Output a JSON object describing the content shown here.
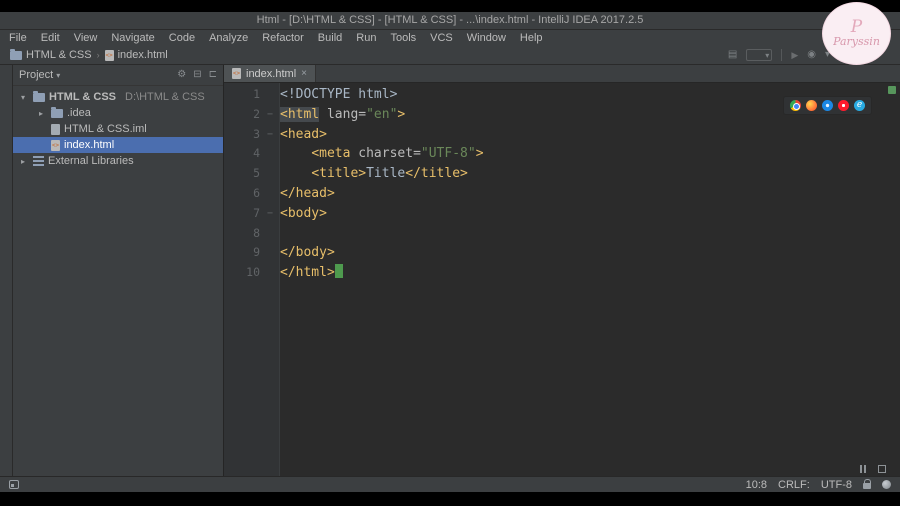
{
  "window": {
    "title": "Html - [D:\\HTML & CSS] - [HTML & CSS] - ...\\index.html - IntelliJ IDEA 2017.2.5"
  },
  "menu": {
    "items": [
      "File",
      "Edit",
      "View",
      "Navigate",
      "Code",
      "Analyze",
      "Refactor",
      "Build",
      "Run",
      "Tools",
      "VCS",
      "Window",
      "Help"
    ]
  },
  "navbar": {
    "crumbs": [
      "HTML & CSS",
      "index.html"
    ]
  },
  "project": {
    "header": "Project",
    "items": [
      {
        "label": "HTML & CSS",
        "hint": "D:\\HTML & CSS"
      },
      {
        "label": ".idea"
      },
      {
        "label": "HTML & CSS.iml"
      },
      {
        "label": "index.html"
      },
      {
        "label": "External Libraries"
      }
    ]
  },
  "editor": {
    "tab": "index.html",
    "browsers": [
      "Chrome",
      "Firefox",
      "Safari",
      "Opera",
      "Internet Explorer"
    ],
    "lines": [
      {
        "num": "1",
        "t": [
          "<!DOCTYPE html>"
        ]
      },
      {
        "num": "2",
        "t": [
          "<html",
          " lang=",
          "\"en\"",
          ">"
        ]
      },
      {
        "num": "3",
        "t": [
          "<head>"
        ]
      },
      {
        "num": "4",
        "t": [
          "    ",
          "<meta",
          " charset=",
          "\"UTF-8\"",
          ">"
        ]
      },
      {
        "num": "5",
        "t": [
          "    ",
          "<title>",
          "Title",
          "</title>"
        ]
      },
      {
        "num": "6",
        "t": [
          "</head>"
        ]
      },
      {
        "num": "7",
        "t": [
          "<body>"
        ]
      },
      {
        "num": "8",
        "t": [
          ""
        ]
      },
      {
        "num": "9",
        "t": [
          "</body>"
        ]
      },
      {
        "num": "10",
        "t": [
          "</html>"
        ]
      }
    ]
  },
  "status": {
    "position": "10:8",
    "line_separator": "CRLF:",
    "encoding": "UTF-8"
  },
  "watermark": {
    "monogram": "P",
    "signature": "Paryssin"
  }
}
